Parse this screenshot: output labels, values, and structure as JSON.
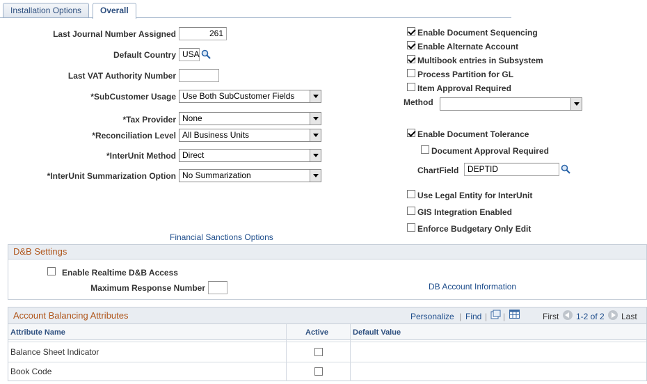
{
  "tabs": [
    {
      "label": "Installation Options",
      "active": false
    },
    {
      "label": "Overall",
      "active": true
    }
  ],
  "left_fields": {
    "last_journal": {
      "label": "Last Journal Number Assigned",
      "value": "261"
    },
    "default_country": {
      "label": "Default Country",
      "value": "USA"
    },
    "last_vat": {
      "label": "Last VAT Authority Number",
      "value": ""
    },
    "subcustomer_usage": {
      "label": "*SubCustomer Usage",
      "value": "Use Both SubCustomer Fields"
    },
    "tax_provider": {
      "label": "*Tax Provider",
      "value": "None"
    },
    "reconciliation_level": {
      "label": "*Reconciliation Level",
      "value": "All Business Units"
    },
    "interunit_method": {
      "label": "*InterUnit Method",
      "value": "Direct"
    },
    "interunit_summarization": {
      "label": "*InterUnit Summarization Option",
      "value": "No Summarization"
    }
  },
  "right_checks": {
    "doc_sequencing": {
      "label": "Enable Document Sequencing",
      "checked": true
    },
    "alt_account": {
      "label": "Enable Alternate Account",
      "checked": true
    },
    "multibook": {
      "label": "Multibook entries in Subsystem",
      "checked": true
    },
    "process_partition": {
      "label": "Process Partition for GL",
      "checked": false
    },
    "item_approval": {
      "label": "Item Approval Required",
      "checked": false
    },
    "method": {
      "label": "Method",
      "value": ""
    },
    "doc_tolerance": {
      "label": "Enable Document Tolerance",
      "checked": true
    },
    "doc_approval": {
      "label": "Document Approval Required",
      "checked": false
    },
    "chartfield": {
      "label": "ChartField",
      "value": "DEPTID"
    },
    "legal_entity": {
      "label": "Use Legal Entity for InterUnit",
      "checked": false
    },
    "gis": {
      "label": "GIS Integration Enabled",
      "checked": false
    },
    "budgetary": {
      "label": "Enforce Budgetary Only Edit",
      "checked": false
    }
  },
  "links": {
    "financial_sanctions": "Financial Sanctions Options",
    "dnb_info": "DB Account Information"
  },
  "dnb": {
    "title": "D&B Settings",
    "realtime": {
      "label": "Enable Realtime D&B Access",
      "checked": false
    },
    "max_response": {
      "label": "Maximum Response Number",
      "value": ""
    }
  },
  "grid": {
    "title": "Account Balancing Attributes",
    "personalize": "Personalize",
    "find": "Find",
    "first": "First",
    "range": "1-2 of 2",
    "last": "Last",
    "columns": [
      "Attribute Name",
      "Active",
      "Default Value"
    ],
    "rows": [
      {
        "name": "Balance Sheet Indicator",
        "active": false,
        "default": ""
      },
      {
        "name": "Book Code",
        "active": false,
        "default": ""
      }
    ]
  },
  "colors": {
    "link": "#1f4e8c",
    "group_title": "#b0561b",
    "tab_text": "#2d4f7f"
  }
}
